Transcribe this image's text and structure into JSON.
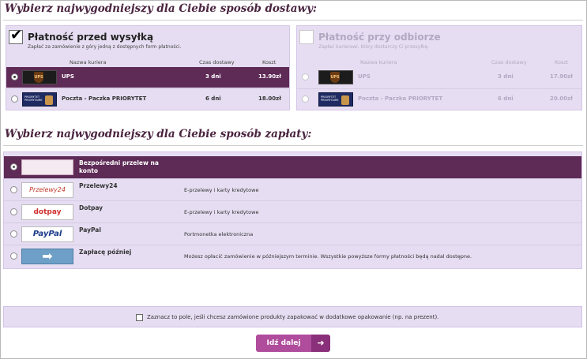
{
  "delivery": {
    "heading": "Wybierz najwygodniejszy dla Ciebie sposób dostawy:",
    "prepaid": {
      "title": "Płatność przed wysyłką",
      "subtitle": "Zapłać za zamówienie z góry jedną z dostępnych form płatności.",
      "columns": {
        "courier": "Nazwa kuriera",
        "time": "Czas dostawy",
        "cost": "Koszt"
      },
      "rows": [
        {
          "name": "UPS",
          "time": "3 dni",
          "cost": "13.90zł",
          "logo_label": "UPS"
        },
        {
          "name": "Poczta - Paczka PRIORYTET",
          "time": "6 dni",
          "cost": "18.00zł",
          "logo_label": "PRIORYTET PRIORYTAIRE"
        }
      ]
    },
    "cod": {
      "title": "Płatność przy odbiorze",
      "subtitle": "Zapłać kurierowi, który dostarczy Ci przesyłkę.",
      "columns": {
        "courier": "Nazwa kuriera",
        "time": "Czas dostawy",
        "cost": "Koszt"
      },
      "rows": [
        {
          "name": "UPS",
          "time": "3 dni",
          "cost": "17.90zł",
          "logo_label": "UPS"
        },
        {
          "name": "Poczta - Paczka PRIORYTET",
          "time": "6 dni",
          "cost": "20.00zł",
          "logo_label": "PRIORYTET PRIORYTAIRE"
        }
      ]
    }
  },
  "payment": {
    "heading": "Wybierz najwygodniejszy dla Ciebie sposób zapłaty:",
    "rows": [
      {
        "name": "Bezpośredni przelew na konto",
        "desc": "",
        "logo": ""
      },
      {
        "name": "Przelewy24",
        "desc": "E-przelewy i karty kredytowe",
        "logo": "Przelewy24"
      },
      {
        "name": "Dotpay",
        "desc": "E-przelewy i karty kredytowe",
        "logo": "dotpay"
      },
      {
        "name": "PayPal",
        "desc": "Portmonetka elektroniczna",
        "logo": "PayPal"
      },
      {
        "name": "Zapłacę później",
        "desc": "Możesz opłacić zamówienie w późniejszym terminie. Wszystkie powyższe formy płatności będą nadal dostępne.",
        "logo": ""
      }
    ]
  },
  "gift": {
    "label": "Zaznacz to pole, jeśli chcesz zamówione produkty zapakować w dodatkowe opakowanie (np. na prezent)."
  },
  "next_button": {
    "label": "Idź dalej",
    "arrow": "➜"
  },
  "colors": {
    "accent": "#5e2a56",
    "panel": "#e6ddf2",
    "button": "#b04c9c"
  }
}
